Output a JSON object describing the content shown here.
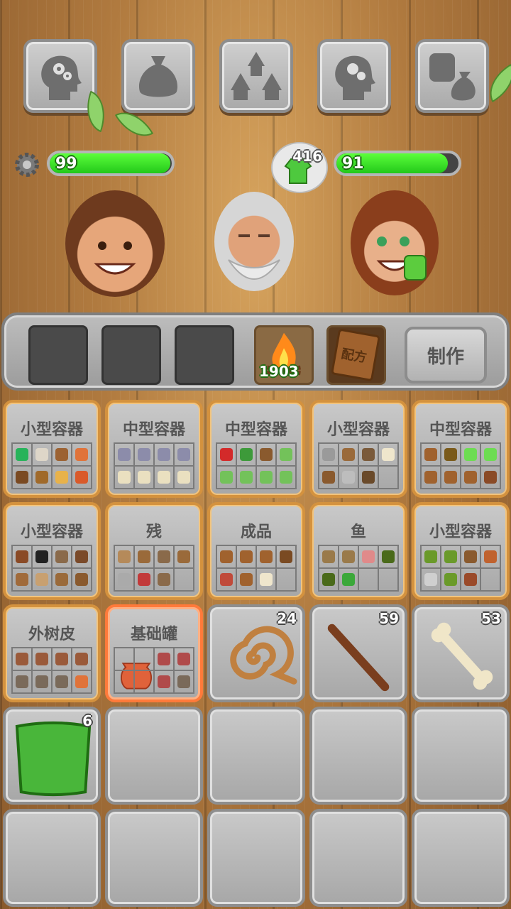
{
  "colors": {
    "health": "#34e024",
    "wood": "#b07a3f",
    "stone": "#b5b5b5",
    "container_border": "#d4923e",
    "highlight_border": "#ff7a3a"
  },
  "top_buttons": [
    {
      "name": "skills-head-icon"
    },
    {
      "name": "sack-icon"
    },
    {
      "name": "huts-icon"
    },
    {
      "name": "skills-head-icon-2"
    },
    {
      "name": "fist-sack-icon"
    }
  ],
  "status": {
    "left_health": "99",
    "left_health_fraction": 0.99,
    "right_health": "91",
    "right_health_fraction": 0.91,
    "bubble_count": "416"
  },
  "craft": {
    "fire_count": "1903",
    "recipe_label": "配方",
    "make_label": "制作"
  },
  "containers": [
    {
      "title": "小型容器",
      "items": [
        "#27b35a",
        "#ded6c8",
        "#9c6232",
        "#e0733a",
        "#7a4a22",
        "#a06a2a",
        "#e8b24a",
        "#d95a2a"
      ]
    },
    {
      "title": "中型容器",
      "items": [
        "#8c8caa",
        "#8c8caa",
        "#8c8caa",
        "#8c8caa",
        "#eae0c0",
        "#eae0c0",
        "#eae0c0",
        "#eae0c0"
      ]
    },
    {
      "title": "中型容器",
      "items": [
        "#d32a2a",
        "#3d9a3a",
        "#8a5a2e",
        "#73c25a",
        "#73c25a",
        "#73c25a",
        "#73c25a",
        "#73c25a"
      ]
    },
    {
      "title": "小型容器",
      "items": [
        "#9a9a9a",
        "#9a6a3a",
        "#7a5a3a",
        "#efe6cc",
        "#8a5a2e",
        "#bdbdbd",
        "#6a4a2a",
        ""
      ]
    },
    {
      "title": "中型容器",
      "items": [
        "#a0622e",
        "#7a5a1a",
        "#6ddc52",
        "#6ddc52",
        "#a0622e",
        "#a0622e",
        "#a0622e",
        "#8a4a26"
      ]
    },
    {
      "title": "小型容器",
      "items": [
        "#8a4a26",
        "#222222",
        "#8a6a4a",
        "#7a4a2a",
        "#a06a3a",
        "#c8a070",
        "#9a6a3a",
        "#8a5a2e"
      ]
    },
    {
      "title": "残",
      "items": [
        "#b58a5a",
        "#9a6a3a",
        "#8a6a4a",
        "#9a6a3a",
        "#aaaaaa",
        "#c23a3a",
        "#8a6a4a",
        ""
      ]
    },
    {
      "title": "成品",
      "items": [
        "#a0622e",
        "#a0622e",
        "#a0622e",
        "#7a4a22",
        "#c04a3a",
        "#a0622e",
        "#efe6cc",
        ""
      ]
    },
    {
      "title": "鱼",
      "items": [
        "#9a7a4a",
        "#9a7a4a",
        "#e08a8a",
        "#4a6a1a",
        "#4a6a1a",
        "#3ba83a",
        "",
        ""
      ]
    },
    {
      "title": "小型容器",
      "items": [
        "#6a9a2a",
        "#6a9a2a",
        "#8a5a2e",
        "#c0622e",
        "#cfcfcf",
        "#6a9a2a",
        "#9a4a2a",
        ""
      ]
    },
    {
      "title": "外树皮",
      "items": [
        "#9a5a3a",
        "#9a5a3a",
        "#9a5a3a",
        "#9a5a3a",
        "#7a6a5a",
        "#7a6a5a",
        "#7a6a5a",
        "#e0733a"
      ]
    },
    {
      "title": "基础罐",
      "items": [
        "",
        "",
        "#b04a4a",
        "#b04a4a",
        "",
        "",
        "#b04a4a",
        "#7a6a5a"
      ]
    }
  ],
  "stacks": [
    {
      "name": "rope",
      "count": "24"
    },
    {
      "name": "stick",
      "count": "59"
    },
    {
      "name": "bone",
      "count": "53"
    },
    {
      "name": "green-fiber-cloth",
      "count": "6"
    }
  ]
}
